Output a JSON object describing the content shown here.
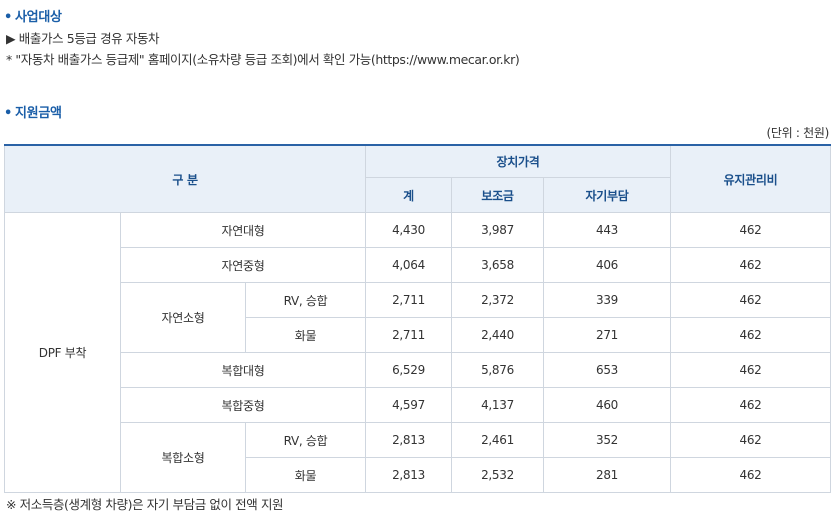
{
  "section1": {
    "title": "사업대상",
    "line1": "▶ 배출가스 5등급 경유 자동차",
    "line2": "* \"자동차 배출가스 등급제\" 홈페이지(소유차량 등급 조회)에서 확인 가능(https://www.mecar.or.kr)"
  },
  "section2": {
    "title": "지원금액",
    "unit": "(단위 : 천원)"
  },
  "table": {
    "headers": {
      "category": "구 분",
      "device_price": "장치가격",
      "total": "계",
      "subsidy": "보조금",
      "self_pay": "자기부담",
      "maintenance": "유지관리비"
    },
    "group_label": "DPF 부착",
    "rows": [
      {
        "type": "자연대형",
        "sub": "",
        "total": "4,430",
        "subsidy": "3,987",
        "self_pay": "443",
        "maintenance": "462"
      },
      {
        "type": "자연중형",
        "sub": "",
        "total": "4,064",
        "subsidy": "3,658",
        "self_pay": "406",
        "maintenance": "462"
      },
      {
        "type": "자연소형",
        "sub": "RV, 승합",
        "total": "2,711",
        "subsidy": "2,372",
        "self_pay": "339",
        "maintenance": "462"
      },
      {
        "type": "",
        "sub": "화물",
        "total": "2,711",
        "subsidy": "2,440",
        "self_pay": "271",
        "maintenance": "462"
      },
      {
        "type": "복합대형",
        "sub": "",
        "total": "6,529",
        "subsidy": "5,876",
        "self_pay": "653",
        "maintenance": "462"
      },
      {
        "type": "복합중형",
        "sub": "",
        "total": "4,597",
        "subsidy": "4,137",
        "self_pay": "460",
        "maintenance": "462"
      },
      {
        "type": "복합소형",
        "sub": "RV, 승합",
        "total": "2,813",
        "subsidy": "2,461",
        "self_pay": "352",
        "maintenance": "462"
      },
      {
        "type": "",
        "sub": "화물",
        "total": "2,813",
        "subsidy": "2,532",
        "self_pay": "281",
        "maintenance": "462"
      }
    ]
  },
  "note": "※ 저소득층(생계형 차량)은 자기 부담금 없이 전액 지원",
  "colors": {
    "accent": "#1a5ea8",
    "header_bg": "#e9f0f8",
    "border": "#cfd6df"
  }
}
